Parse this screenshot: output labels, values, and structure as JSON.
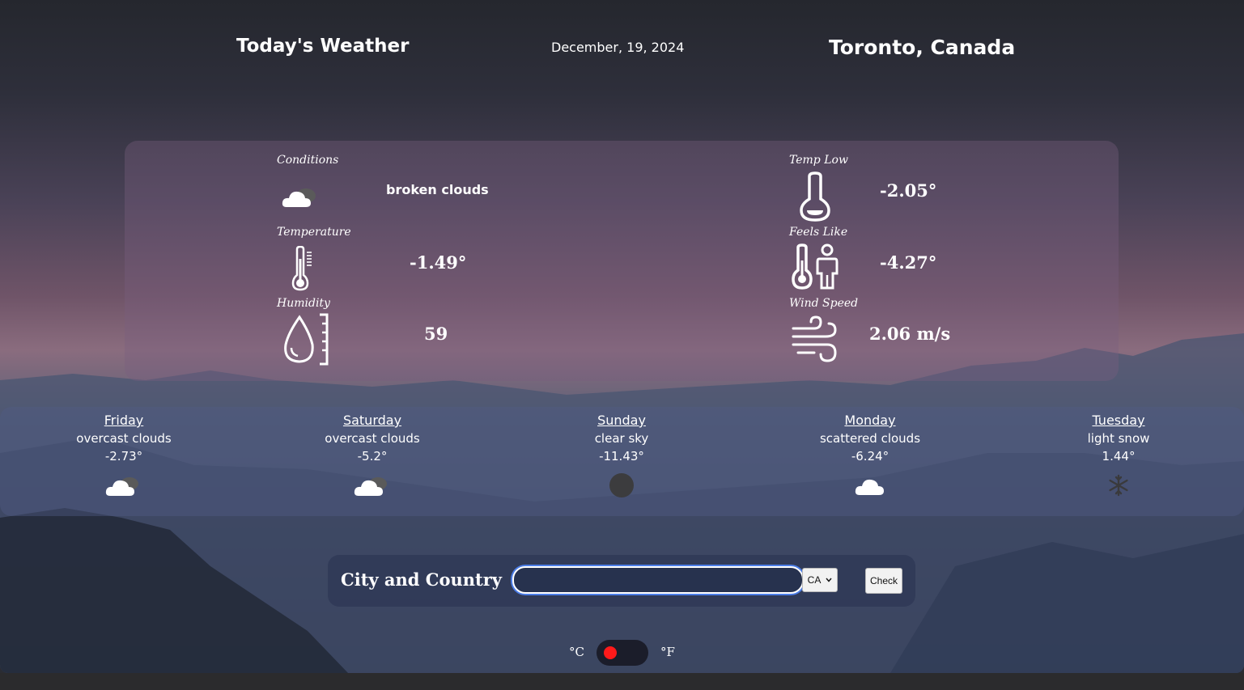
{
  "header": {
    "title": "Today's Weather",
    "date": "December, 19, 2024",
    "location": "Toronto, Canada"
  },
  "today": {
    "conditions": {
      "label": "Conditions",
      "value": "broken clouds",
      "icon": "broken-clouds-icon"
    },
    "temperature": {
      "label": "Temperature",
      "value": "-1.49°",
      "icon": "thermometer-icon"
    },
    "humidity": {
      "label": "Humidity",
      "value": "59",
      "icon": "humidity-icon"
    },
    "temp_low": {
      "label": "Temp Low",
      "value": "-2.05°",
      "icon": "thermometer-low-icon"
    },
    "feels_like": {
      "label": "Feels Like",
      "value": "-4.27°",
      "icon": "feels-like-icon"
    },
    "wind_speed": {
      "label": "Wind Speed",
      "value": "2.06 m/s",
      "icon": "wind-icon"
    }
  },
  "forecast": [
    {
      "day": "Friday",
      "desc": "overcast clouds",
      "temp": "-2.73°",
      "icon": "overcast-clouds-icon"
    },
    {
      "day": "Saturday",
      "desc": "overcast clouds",
      "temp": "-5.2°",
      "icon": "overcast-clouds-icon"
    },
    {
      "day": "Sunday",
      "desc": "clear sky",
      "temp": "-11.43°",
      "icon": "clear-sky-icon"
    },
    {
      "day": "Monday",
      "desc": "scattered clouds",
      "temp": "-6.24°",
      "icon": "scattered-clouds-icon"
    },
    {
      "day": "Tuesday",
      "desc": "light snow",
      "temp": "1.44°",
      "icon": "snowflake-icon"
    }
  ],
  "search": {
    "label": "City and Country",
    "input_value": "",
    "country_selected": "CA",
    "check_label": "Check"
  },
  "units": {
    "celsius_label": "°C",
    "fahrenheit_label": "°F",
    "selected": "celsius"
  },
  "colors": {
    "toggle_knob": "#ff1a1a",
    "input_focus_ring": "#4c7ee8"
  }
}
